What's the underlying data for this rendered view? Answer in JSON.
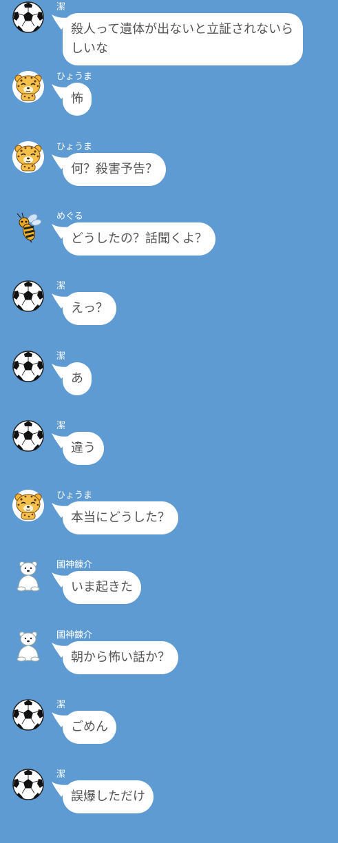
{
  "chat": {
    "messages": [
      {
        "sender": "潔",
        "avatar": "soccer-ball-icon",
        "text": "殺人って遺体が出ないと立証されないらしいな"
      },
      {
        "sender": "ひょうま",
        "avatar": "leopard-icon",
        "text": "怖"
      },
      {
        "sender": "ひょうま",
        "avatar": "leopard-icon",
        "text": "何？殺害予告？"
      },
      {
        "sender": "めぐる",
        "avatar": "bee-icon",
        "text": "どうしたの？話聞くよ？"
      },
      {
        "sender": "潔",
        "avatar": "soccer-ball-icon",
        "text": "えっ？"
      },
      {
        "sender": "潔",
        "avatar": "soccer-ball-icon",
        "text": "あ"
      },
      {
        "sender": "潔",
        "avatar": "soccer-ball-icon",
        "text": "違う"
      },
      {
        "sender": "ひょうま",
        "avatar": "leopard-icon",
        "text": "本当にどうした？"
      },
      {
        "sender": "國神錬介",
        "avatar": "polar-bear-icon",
        "text": "いま起きた"
      },
      {
        "sender": "國神錬介",
        "avatar": "polar-bear-icon",
        "text": "朝から怖い話か？"
      },
      {
        "sender": "潔",
        "avatar": "soccer-ball-icon",
        "text": "ごめん"
      },
      {
        "sender": "潔",
        "avatar": "soccer-ball-icon",
        "text": "誤爆しただけ"
      }
    ]
  }
}
